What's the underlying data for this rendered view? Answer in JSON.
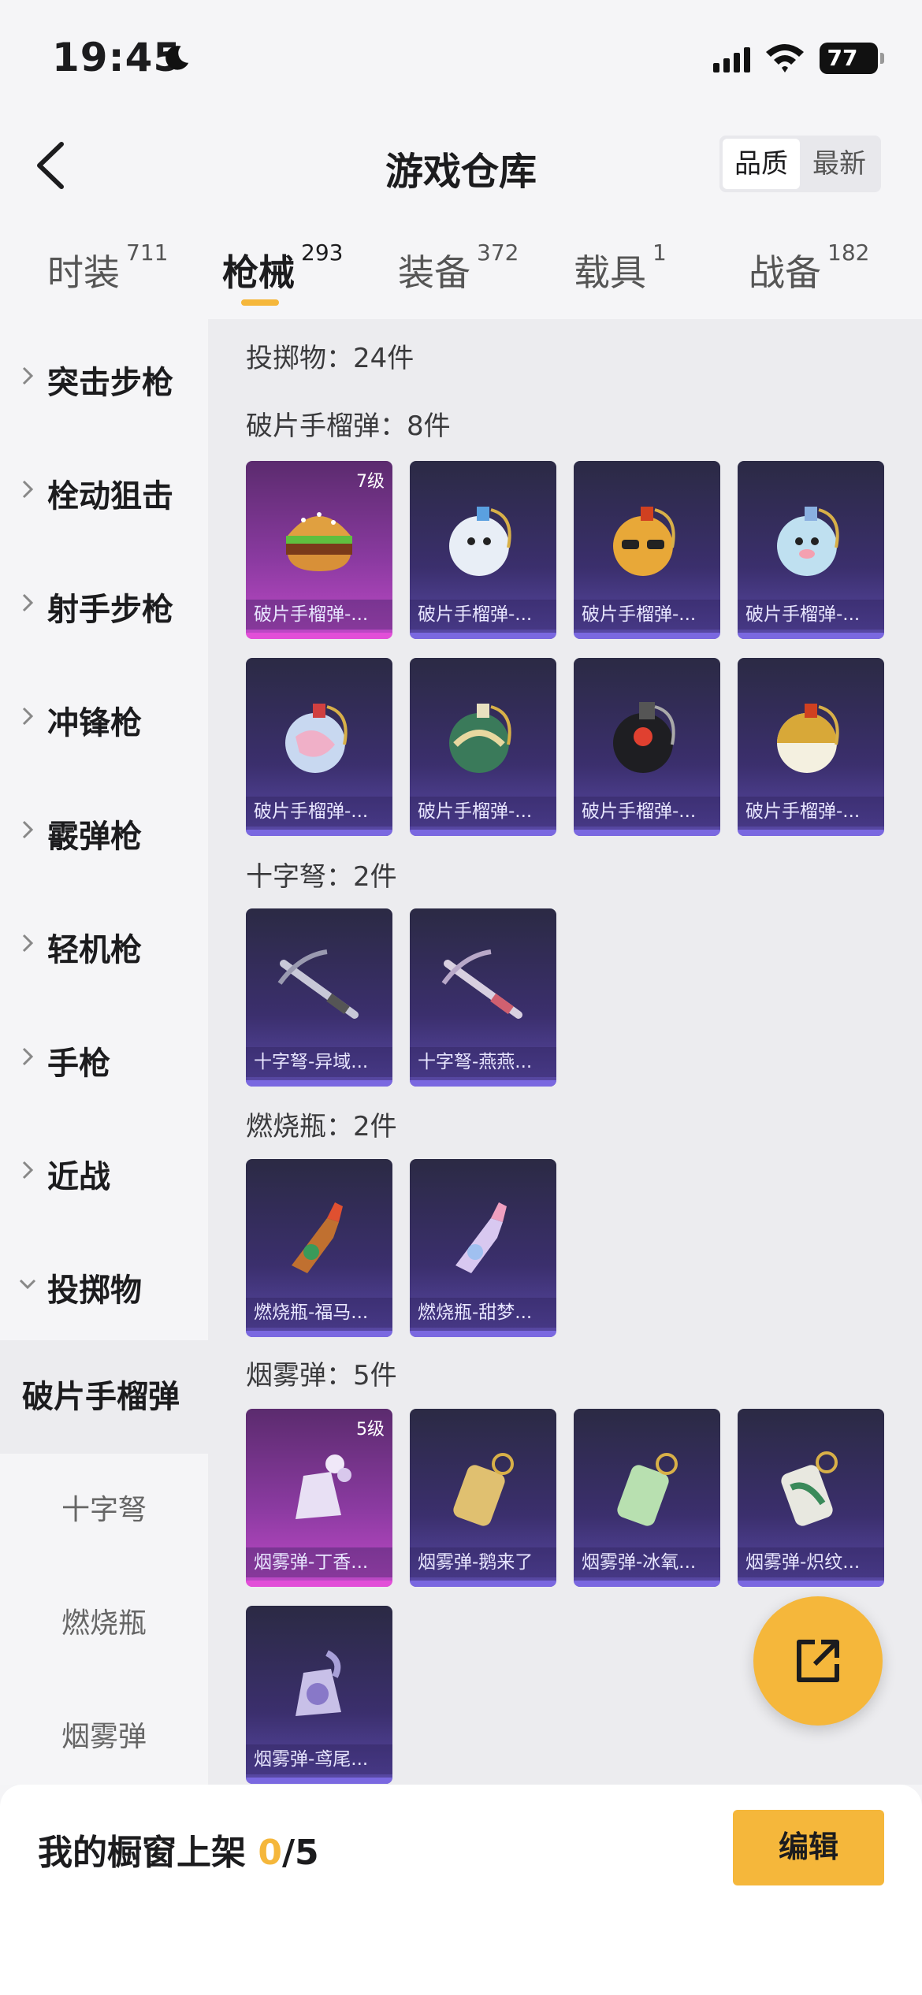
{
  "status": {
    "time": "19:45",
    "battery": "77"
  },
  "header": {
    "title": "游戏仓库",
    "sort": [
      "品质",
      "最新"
    ]
  },
  "tabs": [
    {
      "label": "时装",
      "count": "711"
    },
    {
      "label": "枪械",
      "count": "293"
    },
    {
      "label": "装备",
      "count": "372"
    },
    {
      "label": "载具",
      "count": "1"
    },
    {
      "label": "战备",
      "count": "182"
    }
  ],
  "sidebar": {
    "groups": [
      "突击步枪",
      "栓动狙击",
      "射手步枪",
      "冲锋枪",
      "霰弹枪",
      "轻机枪",
      "手枪",
      "近战",
      "投掷物"
    ],
    "subs": [
      "破片手榴弹",
      "十字弩",
      "燃烧瓶",
      "烟雾弹"
    ]
  },
  "main": {
    "total": "投掷物：24件",
    "sections": [
      {
        "title": "破片手榴弹：8件",
        "items": [
          {
            "name": "破片手榴弹-...",
            "level": "7级"
          },
          {
            "name": "破片手榴弹-..."
          },
          {
            "name": "破片手榴弹-..."
          },
          {
            "name": "破片手榴弹-..."
          },
          {
            "name": "破片手榴弹-..."
          },
          {
            "name": "破片手榴弹-..."
          },
          {
            "name": "破片手榴弹-..."
          },
          {
            "name": "破片手榴弹-..."
          }
        ]
      },
      {
        "title": "十字弩：2件",
        "items": [
          {
            "name": "十字弩-异域..."
          },
          {
            "name": "十字弩-燕燕..."
          }
        ]
      },
      {
        "title": "燃烧瓶：2件",
        "items": [
          {
            "name": "燃烧瓶-福马..."
          },
          {
            "name": "燃烧瓶-甜梦..."
          }
        ]
      },
      {
        "title": "烟雾弹：5件",
        "items": [
          {
            "name": "烟雾弹-丁香...",
            "level": "5级"
          },
          {
            "name": "烟雾弹-鹅来了"
          },
          {
            "name": "烟雾弹-冰氧..."
          },
          {
            "name": "烟雾弹-炽纹..."
          },
          {
            "name": "烟雾弹-鸢尾..."
          }
        ]
      }
    ]
  },
  "bottom": {
    "label": "我的橱窗上架",
    "current": "0",
    "total": "/5",
    "edit": "编辑"
  },
  "colors": {
    "accent": "#f5b73b",
    "card": "#3b2f6d",
    "card_legendary": "#8a3aa0"
  }
}
